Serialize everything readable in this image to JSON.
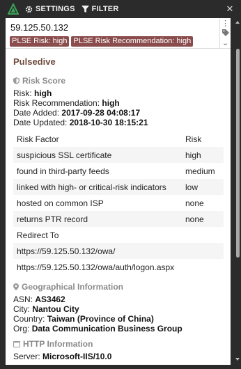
{
  "toolbar": {
    "settings_label": "SETTINGS",
    "filter_label": "FILTER",
    "accent_color": "#3aa35a"
  },
  "indicator": {
    "value": "59.125.50.132",
    "tags": [
      "PLSE Risk: high",
      "PLSE Risk Recommendation: high"
    ]
  },
  "source_title": "Pulsedive",
  "risk_score": {
    "heading": "Risk Score",
    "risk_label": "Risk:",
    "risk_value": "high",
    "recommendation_label": "Risk Recommendation:",
    "recommendation_value": "high",
    "added_label": "Date Added:",
    "added_value": "2017-09-28 04:08:17",
    "updated_label": "Date Updated:",
    "updated_value": "2018-10-30 18:15:21"
  },
  "risk_table": {
    "columns": [
      "Risk Factor",
      "Risk"
    ],
    "rows": [
      [
        "suspicious SSL certificate",
        "high"
      ],
      [
        "found in third-party feeds",
        "medium"
      ],
      [
        "linked with high- or critical-risk indicators",
        "low"
      ],
      [
        "hosted on common ISP",
        "none"
      ],
      [
        "returns PTR record",
        "none"
      ]
    ]
  },
  "redirects": {
    "heading": "Redirect To",
    "urls": [
      "https://59.125.50.132/owa/",
      "https://59.125.50.132/owa/auth/logon.aspx"
    ]
  },
  "geo": {
    "heading": "Geographical Information",
    "asn_label": "ASN:",
    "asn_value": "AS3462",
    "city_label": "City:",
    "city_value": "Nantou City",
    "country_label": "Country:",
    "country_value": "Taiwan (Province of China)",
    "org_label": "Org:",
    "org_value": "Data Communication Business Group"
  },
  "http": {
    "heading": "HTTP Information",
    "server_label": "Server:",
    "server_value": "Microsoft-IIS/10.0"
  },
  "icons": {
    "logo": "pulsedive-logo-icon",
    "settings": "gear-icon",
    "filter": "filter-icon",
    "close": "close-icon",
    "more": "vertical-dots-icon",
    "tag": "tag-icon",
    "risk": "shield-icon",
    "geo": "map-pin-icon",
    "http": "server-icon"
  }
}
